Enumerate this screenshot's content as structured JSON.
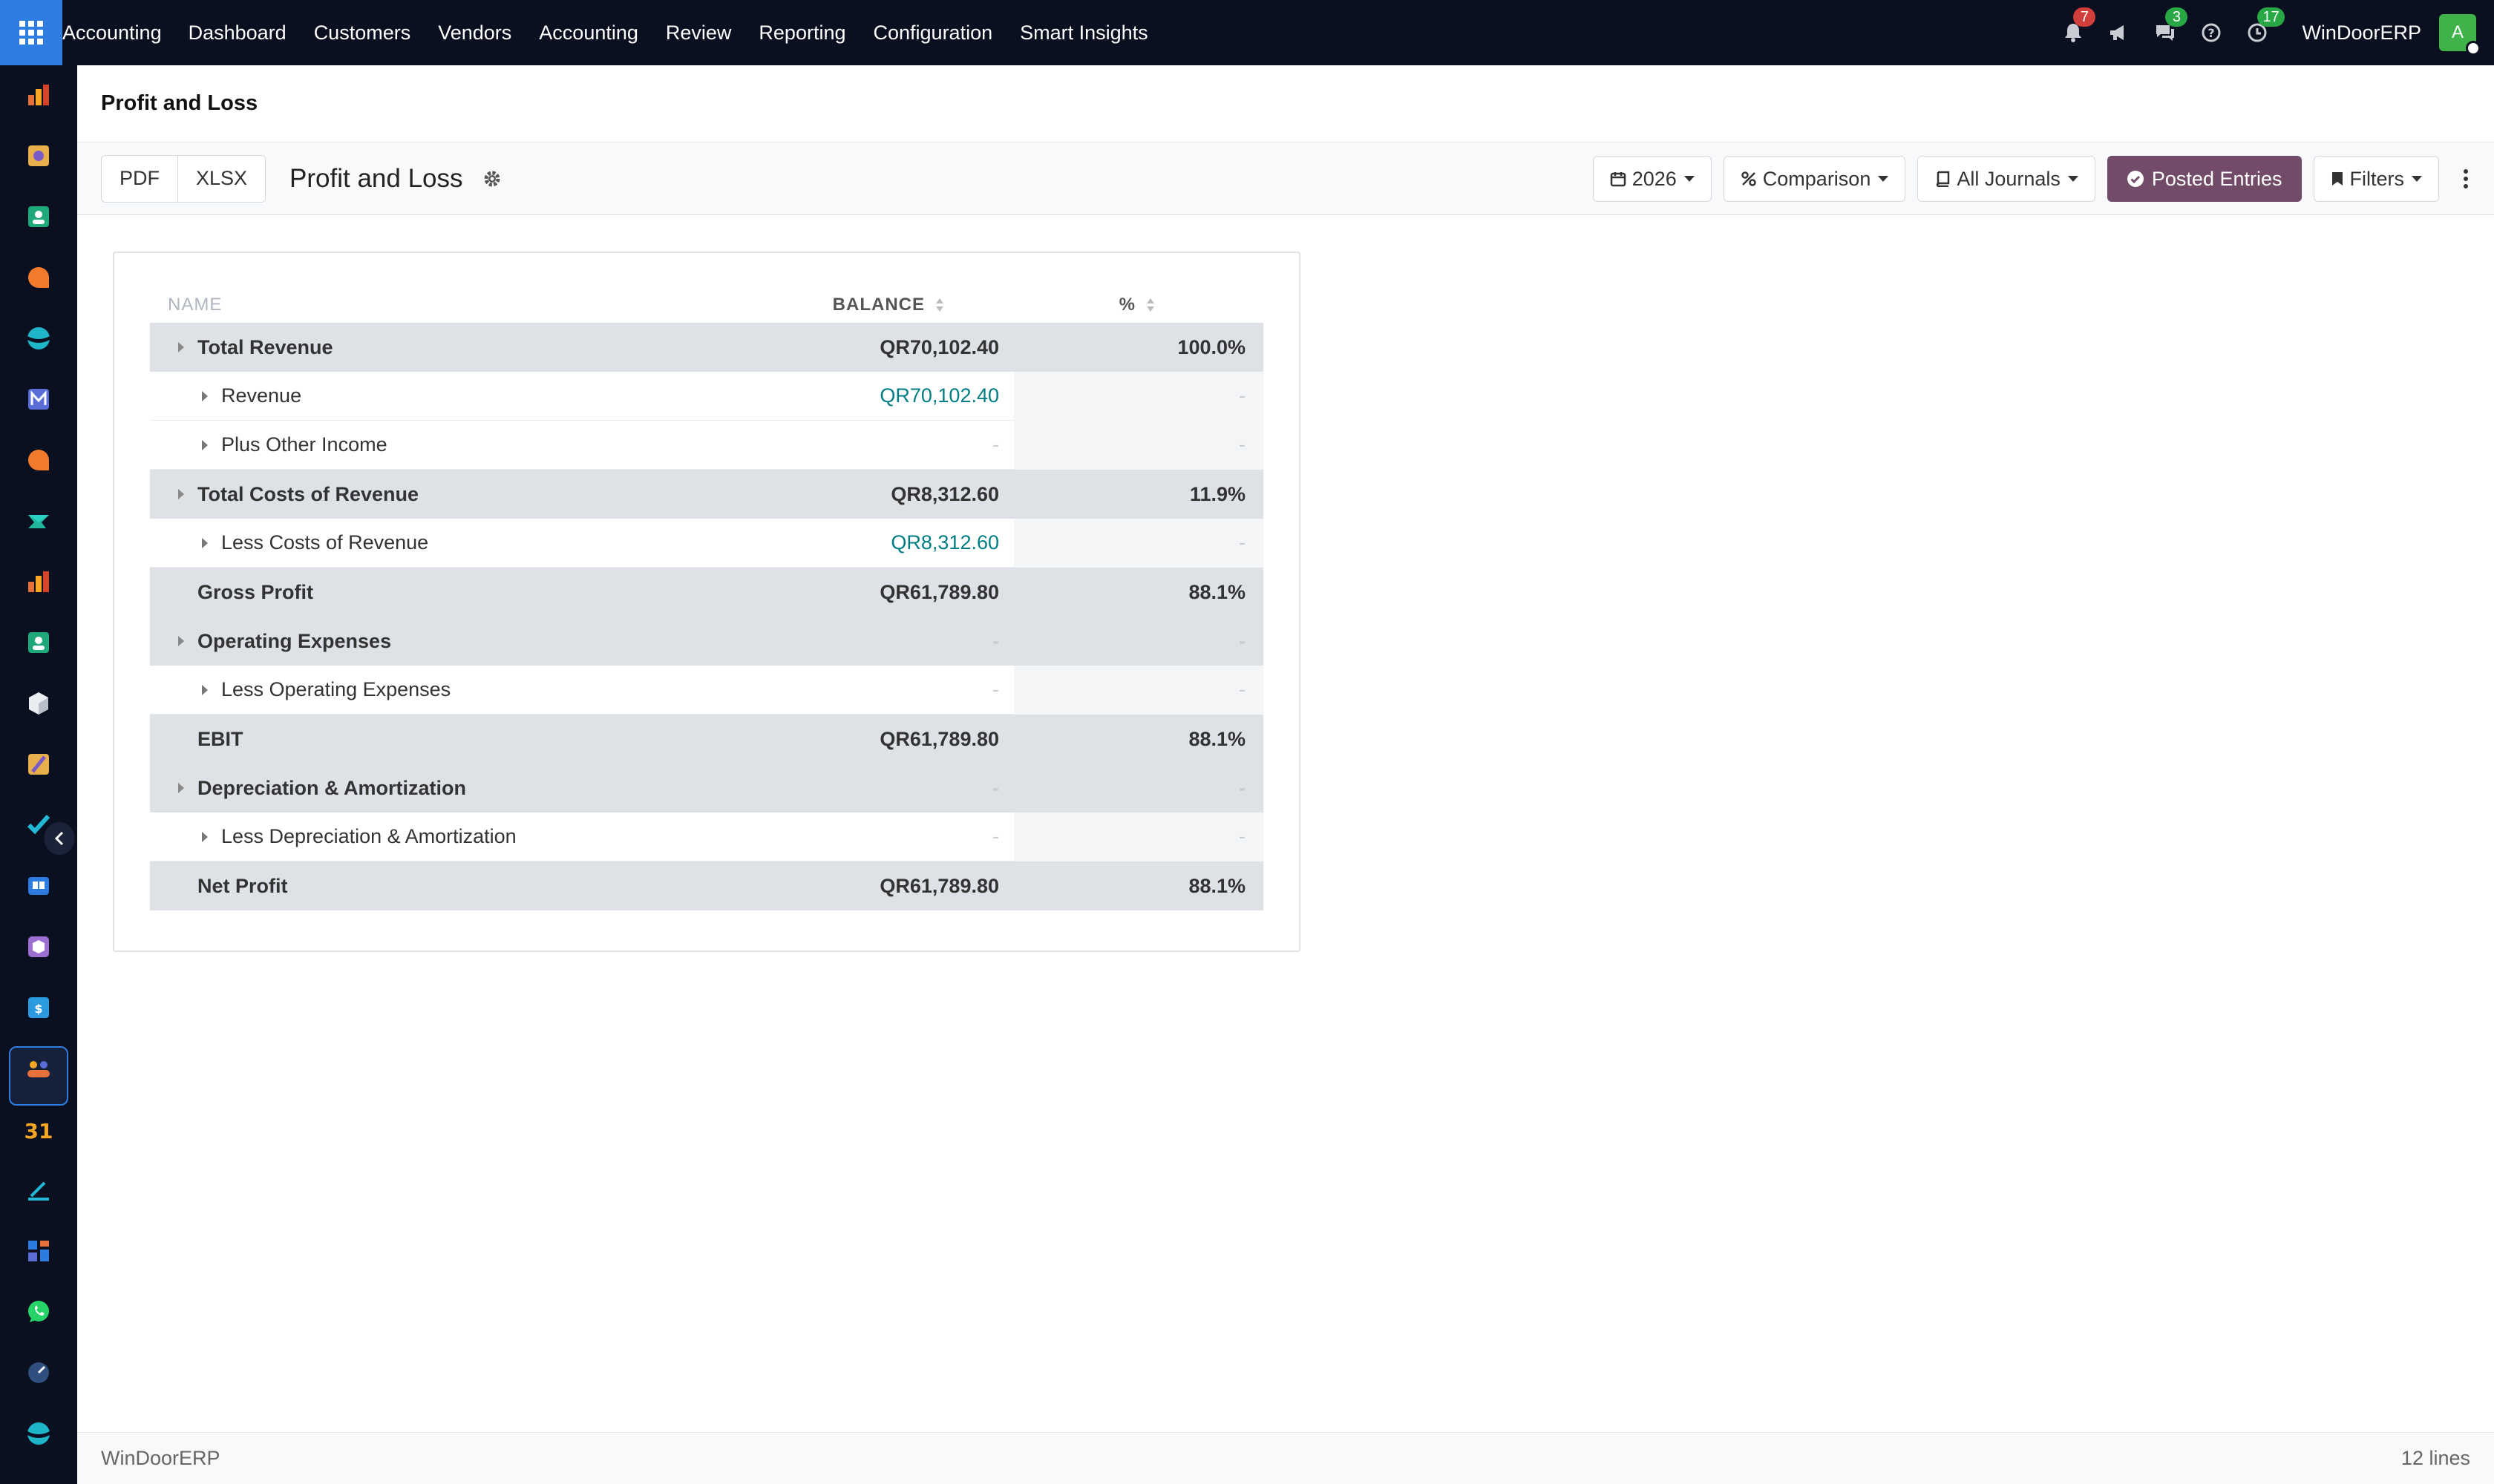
{
  "topbar": {
    "brand": "Accounting",
    "menu": [
      "Dashboard",
      "Customers",
      "Vendors",
      "Accounting",
      "Review",
      "Reporting",
      "Configuration",
      "Smart Insights"
    ],
    "notifications_count": "7",
    "messages_count": "3",
    "activities_count": "17",
    "company": "WinDoorERP",
    "avatar_letter": "A"
  },
  "breadcrumb": {
    "title": "Profit and Loss"
  },
  "control_panel": {
    "export_pdf": "PDF",
    "export_xlsx": "XLSX",
    "report_title": "Profit and Loss",
    "date_filter": "2026",
    "comparison": "Comparison",
    "journals": "All Journals",
    "posted_entries": "Posted Entries",
    "filters": "Filters"
  },
  "table": {
    "headers": {
      "name": "NAME",
      "balance": "BALANCE",
      "percent": "%"
    },
    "rows": [
      {
        "type": "total",
        "expandable": true,
        "name": "Total Revenue",
        "balance": "QR70,102.40",
        "percent": "100.0%"
      },
      {
        "type": "sub",
        "expandable": true,
        "name": "Revenue",
        "balance": "QR70,102.40",
        "percent": "-"
      },
      {
        "type": "sub",
        "expandable": true,
        "name": "Plus Other Income",
        "balance": "-",
        "percent": "-"
      },
      {
        "type": "total",
        "expandable": true,
        "name": "Total Costs of Revenue",
        "balance": "QR8,312.60",
        "percent": "11.9%"
      },
      {
        "type": "sub",
        "expandable": true,
        "name": "Less Costs of Revenue",
        "balance": "QR8,312.60",
        "percent": "-"
      },
      {
        "type": "total",
        "expandable": false,
        "name": "Gross Profit",
        "balance": "QR61,789.80",
        "percent": "88.1%"
      },
      {
        "type": "total",
        "expandable": true,
        "name": "Operating Expenses",
        "balance": "-",
        "percent": "-"
      },
      {
        "type": "sub",
        "expandable": true,
        "name": "Less Operating Expenses",
        "balance": "-",
        "percent": "-"
      },
      {
        "type": "total",
        "expandable": false,
        "name": "EBIT",
        "balance": "QR61,789.80",
        "percent": "88.1%"
      },
      {
        "type": "total",
        "expandable": true,
        "name": "Depreciation & Amortization",
        "balance": "-",
        "percent": "-"
      },
      {
        "type": "sub",
        "expandable": true,
        "name": "Less Depreciation & Amortization",
        "balance": "-",
        "percent": "-"
      },
      {
        "type": "total",
        "expandable": false,
        "name": "Net Profit",
        "balance": "QR61,789.80",
        "percent": "88.1%"
      }
    ]
  },
  "footer": {
    "company": "WinDoorERP",
    "line_count": "12 lines"
  },
  "colors": {
    "topbar_bg": "#0b1020",
    "apps_btn": "#2f7de1",
    "posted_btn": "#714b67",
    "link_teal": "#017e84",
    "badge_red": "#d23f3a",
    "badge_green": "#28a745"
  },
  "sidebar_apps": [
    "reporting-app-icon",
    "sketch-app-icon",
    "contacts-app-icon",
    "discuss-app-icon",
    "website-app-icon",
    "email-marketing-app-icon",
    "chat-app-icon",
    "sales-app-icon",
    "reporting-app-icon",
    "contacts-app-icon",
    "inventory-app-icon",
    "paint-app-icon",
    "tasks-app-icon",
    "knowledge-app-icon",
    "package-app-icon",
    "accounting-app-icon",
    "employees-app-icon",
    "calendar-app-icon",
    "sign-app-icon",
    "dashboards-app-icon",
    "whatsapp-app-icon",
    "timer-app-icon",
    "website-app-icon"
  ]
}
